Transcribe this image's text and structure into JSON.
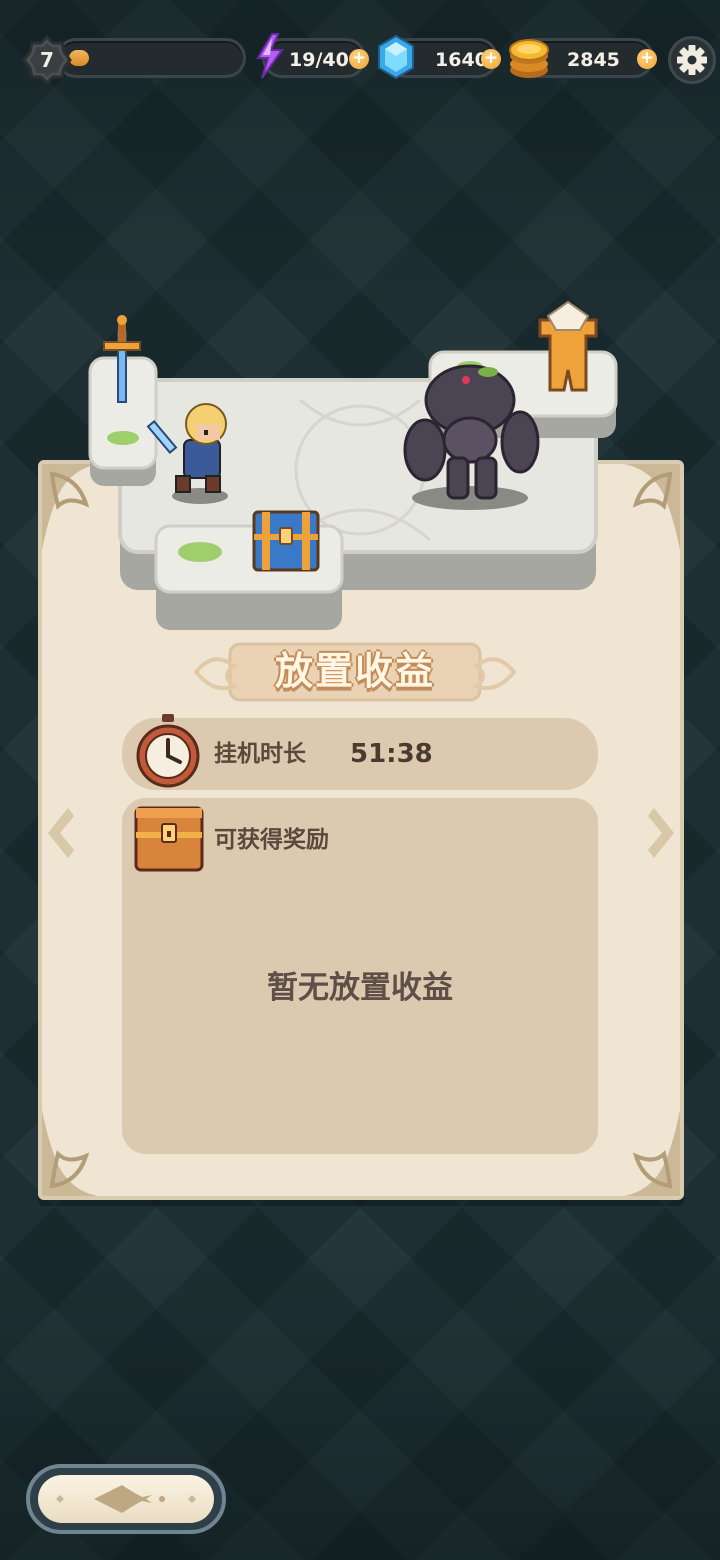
{
  "hud": {
    "level": "7",
    "xp_progress": 0.12,
    "energy": "19/40",
    "gems": "1640",
    "gold": "2845"
  },
  "panel": {
    "title": "放置收益",
    "duration_label": "挂机时长",
    "duration_value": "51:38",
    "reward_label": "可获得奖励",
    "empty_message": "暂无放置收益"
  },
  "icons": {
    "energy": "lightning-icon",
    "gems": "diamond-icon",
    "gold": "gold-coin-icon",
    "settings": "gear-icon",
    "timer": "stopwatch-icon",
    "reward": "treasure-chest-icon"
  },
  "colors": {
    "background": "#1a2c30",
    "panel": "#efe5d2",
    "panel_row": "#dccab0",
    "accent_orange": "#f0a23a",
    "energy_purple": "#a04df0",
    "gem_blue": "#5cc8f5"
  }
}
